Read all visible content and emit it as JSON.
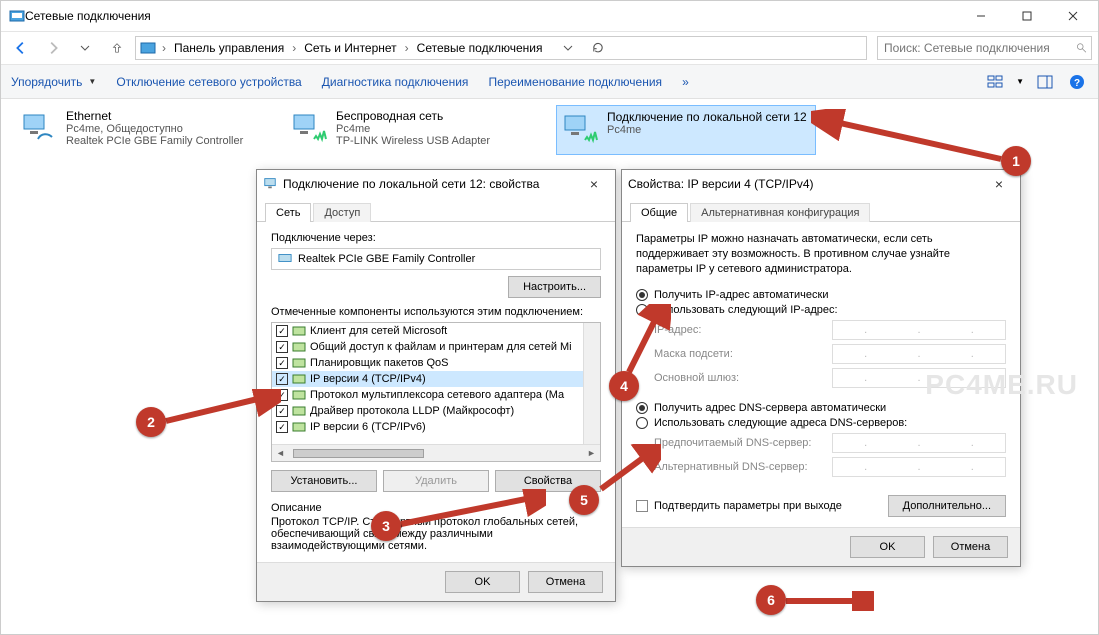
{
  "window": {
    "title": "Сетевые подключения"
  },
  "search": {
    "placeholder": "Поиск: Сетевые подключения"
  },
  "breadcrumbs": [
    "Панель управления",
    "Сеть и Интернет",
    "Сетевые подключения"
  ],
  "commands": {
    "organize": "Упорядочить",
    "disable": "Отключение сетевого устройства",
    "diagnose": "Диагностика подключения",
    "rename": "Переименование подключения"
  },
  "connections": [
    {
      "name": "Ethernet",
      "line2": "Pc4me, Общедоступно",
      "line3": "Realtek PCIe GBE Family Controller"
    },
    {
      "name": "Беспроводная сеть",
      "line2": "Pc4me",
      "line3": "TP-LINK Wireless USB Adapter"
    },
    {
      "name": "Подключение по локальной сети 12",
      "line2": "Pc4me",
      "line3": ""
    }
  ],
  "propsDlg": {
    "title": "Подключение по локальной сети 12: свойства",
    "tabNet": "Сеть",
    "tabAccess": "Доступ",
    "connectVia": "Подключение через:",
    "adapter": "Realtek PCIe GBE Family Controller",
    "configure": "Настроить...",
    "componentsLabel": "Отмеченные компоненты используются этим подключением:",
    "install": "Установить...",
    "remove": "Удалить",
    "props": "Свойства",
    "descLabel": "Описание",
    "descText": "Протокол TCP/IP. Стандартный протокол глобальных сетей, обеспечивающий связь между различными взаимодействующими сетями.",
    "ok": "OK",
    "cancel": "Отмена",
    "components": [
      "Клиент для сетей Microsoft",
      "Общий доступ к файлам и принтерам для сетей Mi",
      "Планировщик пакетов QoS",
      "IP версии 4 (TCP/IPv4)",
      "Протокол мультиплексора сетевого адаптера (Ма",
      "Драйвер протокола LLDP (Майкрософт)",
      "IP версии 6 (TCP/IPv6)"
    ]
  },
  "ipDlg": {
    "title": "Свойства: IP версии 4 (TCP/IPv4)",
    "tabGeneral": "Общие",
    "tabAlt": "Альтернативная конфигурация",
    "intro": "Параметры IP можно назначать автоматически, если сеть поддерживает эту возможность. В противном случае узнайте параметры IP у сетевого администратора.",
    "autoIP": "Получить IP-адрес автоматически",
    "manualIP": "Использовать следующий IP-адрес:",
    "ipAddr": "IP-адрес:",
    "mask": "Маска подсети:",
    "gw": "Основной шлюз:",
    "autoDNS": "Получить адрес DNS-сервера автоматически",
    "manualDNS": "Использовать следующие адреса DNS-серверов:",
    "dns1": "Предпочитаемый DNS-сервер:",
    "dns2": "Альтернативный DNS-сервер:",
    "confirm": "Подтвердить параметры при выходе",
    "advanced": "Дополнительно...",
    "ok": "OK",
    "cancel": "Отмена"
  },
  "markers": [
    "1",
    "2",
    "3",
    "4",
    "5",
    "6"
  ],
  "watermark": "PC4ME.RU"
}
